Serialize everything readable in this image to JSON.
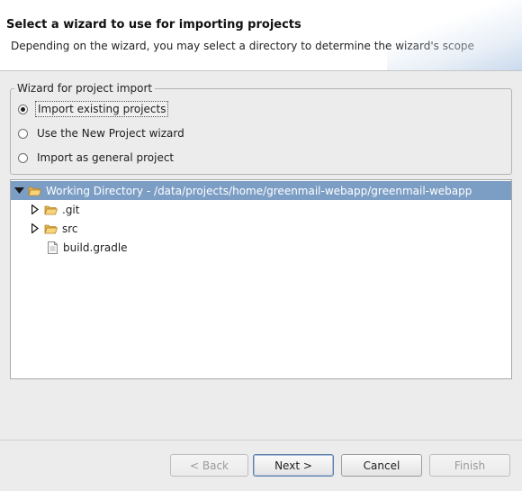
{
  "header": {
    "title": "Select a wizard to use for importing projects",
    "description": "Depending on the wizard, you may select a directory to determine the wizard's scope"
  },
  "wizard_group": {
    "label": "Wizard for project import",
    "options": [
      {
        "label": "Import existing projects",
        "selected": true
      },
      {
        "label": "Use the New Project wizard",
        "selected": false
      },
      {
        "label": "Import as general project",
        "selected": false
      }
    ]
  },
  "tree": {
    "root": {
      "label": "Working Directory - /data/projects/home/greenmail-webapp/greenmail-webapp",
      "expanded": true,
      "icon": "open-folder-icon"
    },
    "children": [
      {
        "label": ".git",
        "type": "folder",
        "icon": "folder-icon"
      },
      {
        "label": "src",
        "type": "folder",
        "icon": "folder-icon"
      },
      {
        "label": "build.gradle",
        "type": "file",
        "icon": "file-icon"
      }
    ]
  },
  "buttons": {
    "back": "< Back",
    "next": "Next >",
    "cancel": "Cancel",
    "finish": "Finish"
  }
}
